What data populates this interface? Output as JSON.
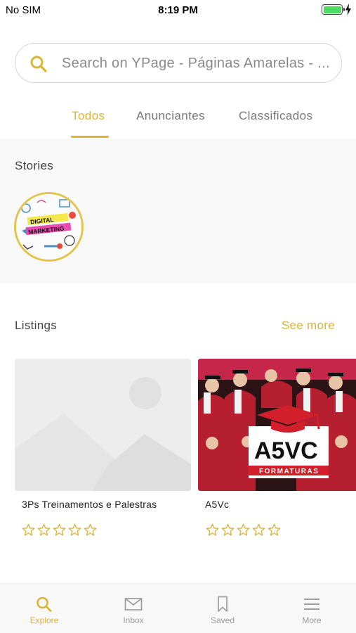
{
  "status_bar": {
    "carrier": "No SIM",
    "time": "8:19 PM",
    "battery_level": 1.0,
    "battery_color": "#4cd964"
  },
  "search": {
    "placeholder": "Search on YPage - Páginas Amarelas - ..."
  },
  "tabs": [
    {
      "label": "Todos",
      "active": true
    },
    {
      "label": "Anunciantes",
      "active": false
    },
    {
      "label": "Classificados",
      "active": false
    }
  ],
  "stories": {
    "title": "Stories",
    "items": [
      {
        "image": "digital-marketing-story"
      }
    ]
  },
  "listings": {
    "title": "Listings",
    "see_more": "See more",
    "items": [
      {
        "name": "3Ps Treinamentos e Palestras",
        "image": "placeholder-image",
        "rating": 0
      },
      {
        "name": "A5Vc",
        "image": "a5vc-formaturas-photo",
        "rating": 0
      }
    ]
  },
  "bottom_nav": [
    {
      "label": "Explore",
      "icon": "search-icon",
      "active": true
    },
    {
      "label": "Inbox",
      "icon": "envelope-icon",
      "active": false
    },
    {
      "label": "Saved",
      "icon": "bookmark-icon",
      "active": false
    },
    {
      "label": "More",
      "icon": "menu-icon",
      "active": false
    }
  ],
  "colors": {
    "accent": "#d8b53a",
    "muted": "#9c9c9c",
    "section_bg": "#f8f8f8"
  }
}
